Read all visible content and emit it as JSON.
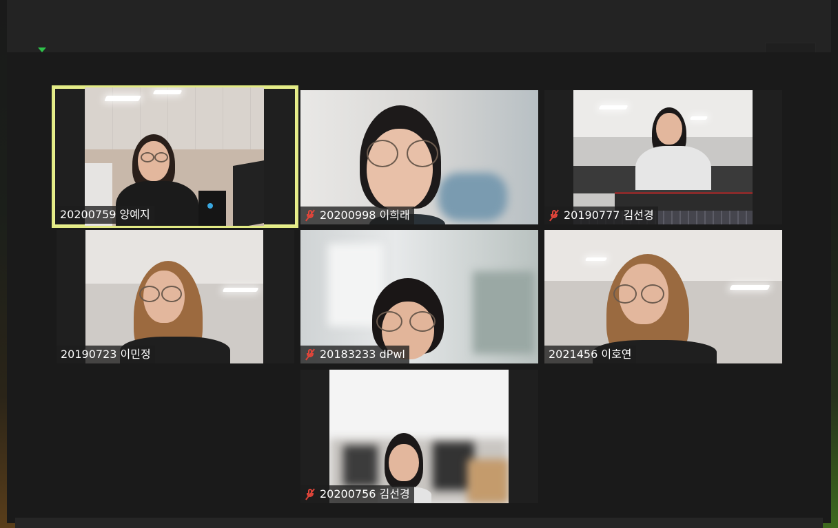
{
  "participants": [
    {
      "id": "20200759",
      "name": "양예지",
      "muted": false,
      "active": true
    },
    {
      "id": "20200998",
      "name": "이희래",
      "muted": true,
      "active": false
    },
    {
      "id": "20190777",
      "name": "김선경",
      "muted": true,
      "active": false
    },
    {
      "id": "20190723",
      "name": "이민정",
      "muted": false,
      "active": false
    },
    {
      "id": "20183233",
      "name": "dPwl",
      "muted": true,
      "active": false
    },
    {
      "id": "2021456",
      "name": "이호연",
      "muted": false,
      "active": false
    },
    {
      "id": "20200756",
      "name": "김선경",
      "muted": true,
      "active": false
    }
  ],
  "labels": [
    "20200759 양예지",
    "20200998 이희래",
    "20190777 김선경",
    "20190723 이민정",
    "20183233 dPwl",
    "2021456 이호연",
    "20200756 김선경"
  ],
  "icons": {
    "mute": "mic-muted-icon",
    "security": "shield-icon"
  },
  "colors": {
    "active_speaker_border": "#e2ea84",
    "muted_icon": "#e0453a",
    "security_green": "#2ec24a"
  }
}
